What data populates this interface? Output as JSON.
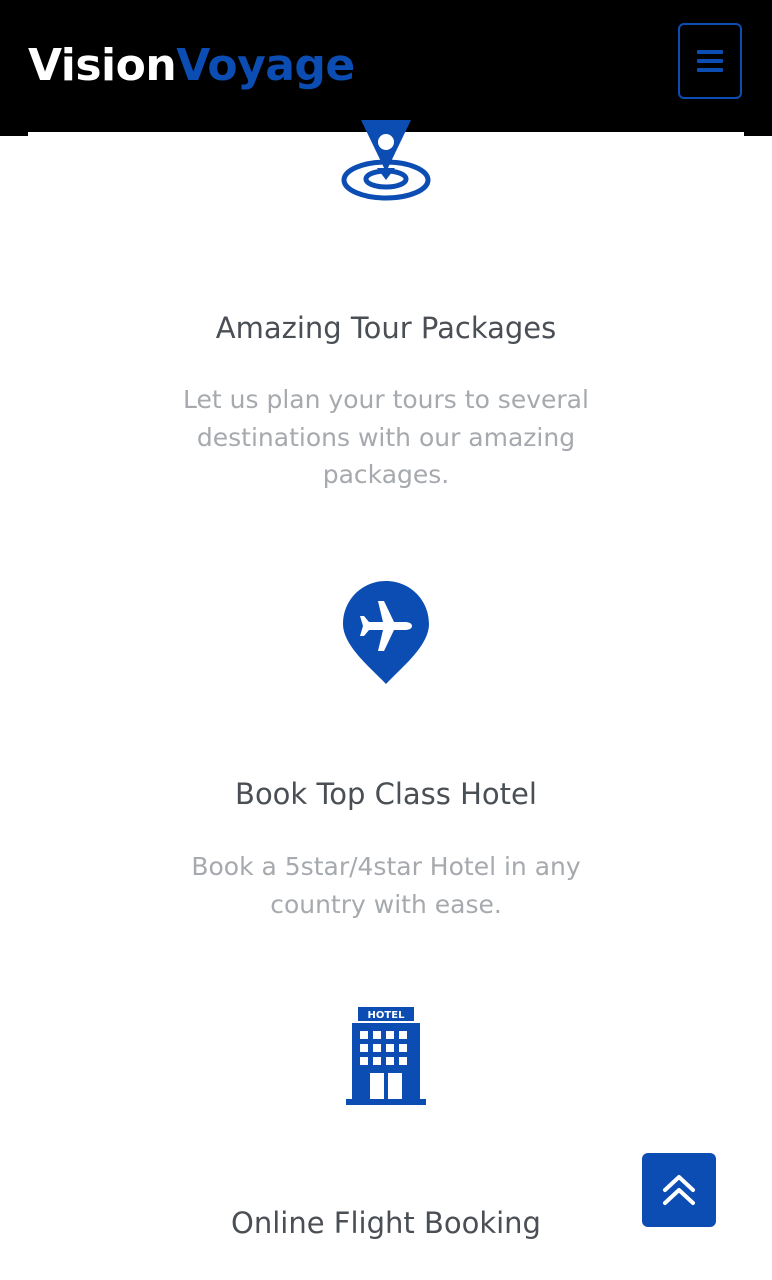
{
  "brand": {
    "part1": "Vision",
    "part2": "Voyage",
    "accent_color": "#0b4db3"
  },
  "header": {
    "menu_icon": "hamburger-menu-icon"
  },
  "features": [
    {
      "icon": "location-pin-icon",
      "title": "",
      "description": ""
    },
    {
      "icon": "location-pin-icon",
      "title": "Amazing Tour Packages",
      "description": "Let us plan your tours to several destinations with our amazing packages."
    },
    {
      "icon": "airplane-pin-icon",
      "title": "Book Top Class Hotel",
      "description": "Book a 5star/4star Hotel in any country with ease."
    },
    {
      "icon": "hotel-building-icon",
      "icon_label": "HOTEL",
      "title": "Online Flight Booking",
      "description": ""
    }
  ],
  "back_to_top": {
    "icon": "double-chevron-up-icon"
  }
}
